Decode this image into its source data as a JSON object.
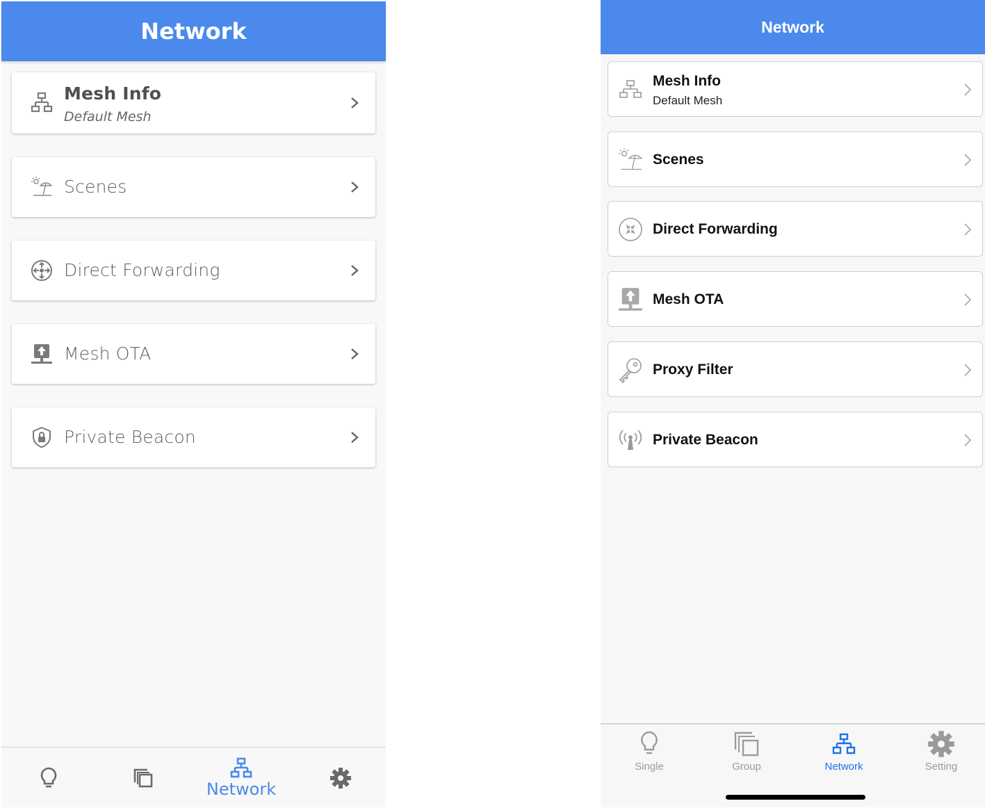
{
  "android": {
    "header": {
      "title": "Network"
    },
    "items": [
      {
        "label": "Mesh Info",
        "sublabel": "Default Mesh",
        "icon": "network-icon"
      },
      {
        "label": "Scenes",
        "icon": "beach-umbrella-icon"
      },
      {
        "label": "Direct Forwarding",
        "icon": "forward-arrows-icon"
      },
      {
        "label": "Mesh OTA",
        "icon": "upload-icon"
      },
      {
        "label": "Private Beacon",
        "icon": "shield-lock-icon"
      }
    ],
    "tabs": [
      {
        "icon": "lightbulb-icon",
        "label": ""
      },
      {
        "icon": "group-copy-icon",
        "label": ""
      },
      {
        "icon": "network-icon",
        "label": "Network",
        "active": true
      },
      {
        "icon": "gear-icon",
        "label": ""
      }
    ]
  },
  "ios": {
    "header": {
      "title": "Network"
    },
    "items": [
      {
        "label": "Mesh Info",
        "sublabel": "Default Mesh",
        "icon": "network-icon"
      },
      {
        "label": "Scenes",
        "icon": "beach-umbrella-icon"
      },
      {
        "label": "Direct Forwarding",
        "icon": "forward-arrows-icon"
      },
      {
        "label": "Mesh OTA",
        "icon": "upload-icon"
      },
      {
        "label": "Proxy Filter",
        "icon": "key-icon"
      },
      {
        "label": "Private Beacon",
        "icon": "broadcast-icon"
      }
    ],
    "tabs": [
      {
        "icon": "lightbulb-icon",
        "label": "Single"
      },
      {
        "icon": "group-copy-icon",
        "label": "Group"
      },
      {
        "icon": "network-icon",
        "label": "Network",
        "active": true
      },
      {
        "icon": "gear-icon",
        "label": "Setting"
      }
    ]
  },
  "colors": {
    "accent": "#4b89ec",
    "active_tab_ios": "#1a73e8",
    "icon_gray": "#8a8a8a"
  }
}
